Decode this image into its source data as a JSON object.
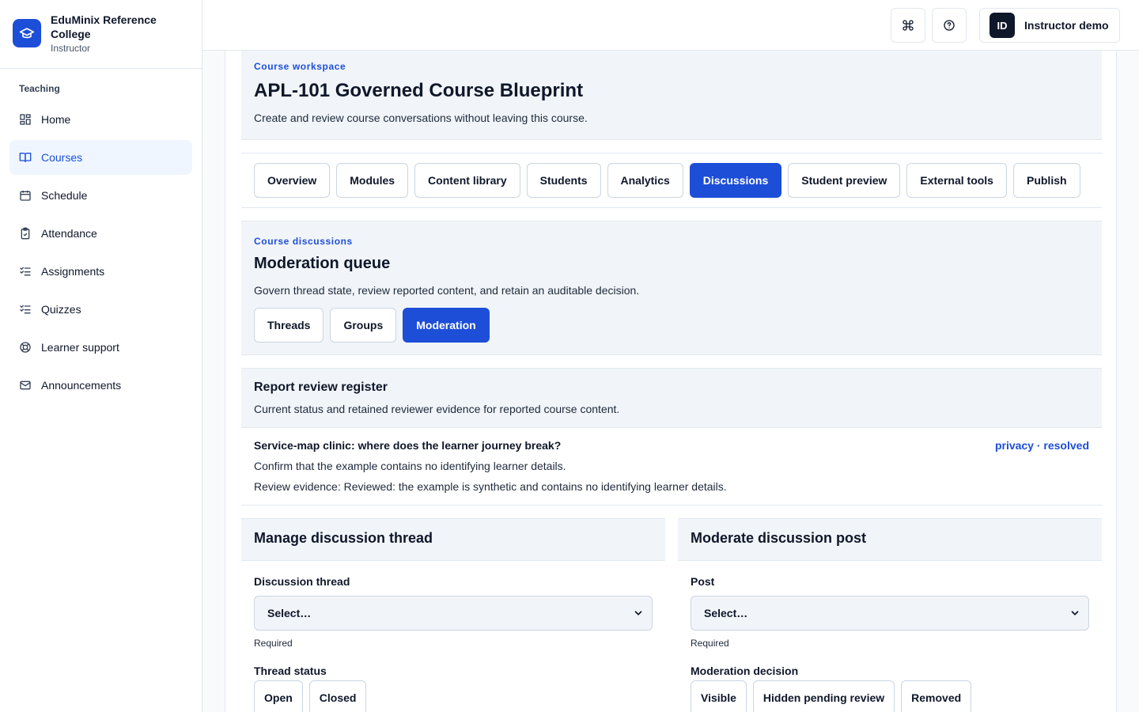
{
  "brand": {
    "name": "EduMinix Reference College",
    "role": "Instructor"
  },
  "sidebar": {
    "section": "Teaching",
    "items": [
      {
        "label": "Home",
        "icon": "dashboard-icon"
      },
      {
        "label": "Courses",
        "icon": "book-open-icon",
        "active": true
      },
      {
        "label": "Schedule",
        "icon": "calendar-icon"
      },
      {
        "label": "Attendance",
        "icon": "clipboard-check-icon"
      },
      {
        "label": "Assignments",
        "icon": "list-check-icon"
      },
      {
        "label": "Quizzes",
        "icon": "list-check-icon"
      },
      {
        "label": "Learner support",
        "icon": "lifebuoy-icon"
      },
      {
        "label": "Announcements",
        "icon": "mail-icon"
      }
    ]
  },
  "header": {
    "user": {
      "initials": "ID",
      "name": "Instructor demo"
    }
  },
  "workspace": {
    "eyebrow": "Course workspace",
    "title": "APL-101 Governed Course Blueprint",
    "description": "Create and review course conversations without leaving this course."
  },
  "tabs": [
    "Overview",
    "Modules",
    "Content library",
    "Students",
    "Analytics",
    "Discussions",
    "Student preview",
    "External tools",
    "Publish"
  ],
  "active_tab": "Discussions",
  "discussions": {
    "eyebrow": "Course discussions",
    "title": "Moderation queue",
    "description": "Govern thread state, review reported content, and retain an auditable decision.",
    "subtabs": [
      "Threads",
      "Groups",
      "Moderation"
    ],
    "active_subtab": "Moderation"
  },
  "register": {
    "title": "Report review register",
    "description": "Current status and retained reviewer evidence for reported course content.",
    "row": {
      "title": "Service-map clinic: where does the learner journey break?",
      "tag": "privacy · resolved",
      "line1": "Confirm that the example contains no identifying learner details.",
      "line2": "Review evidence: Reviewed: the example is synthetic and contains no identifying learner details."
    }
  },
  "thread_panel": {
    "title": "Manage discussion thread",
    "field_label": "Discussion thread",
    "select_value": "Select…",
    "hint": "Required",
    "status_label": "Thread status",
    "options": [
      "Open",
      "Closed"
    ]
  },
  "post_panel": {
    "title": "Moderate discussion post",
    "field_label": "Post",
    "select_value": "Select…",
    "hint": "Required",
    "status_label": "Moderation decision",
    "options": [
      "Visible",
      "Hidden pending review",
      "Removed"
    ]
  },
  "colors": {
    "accent": "#1d4ed8",
    "text": "#0f172a",
    "panel": "#f1f5f9",
    "border": "#e2e8f0"
  }
}
